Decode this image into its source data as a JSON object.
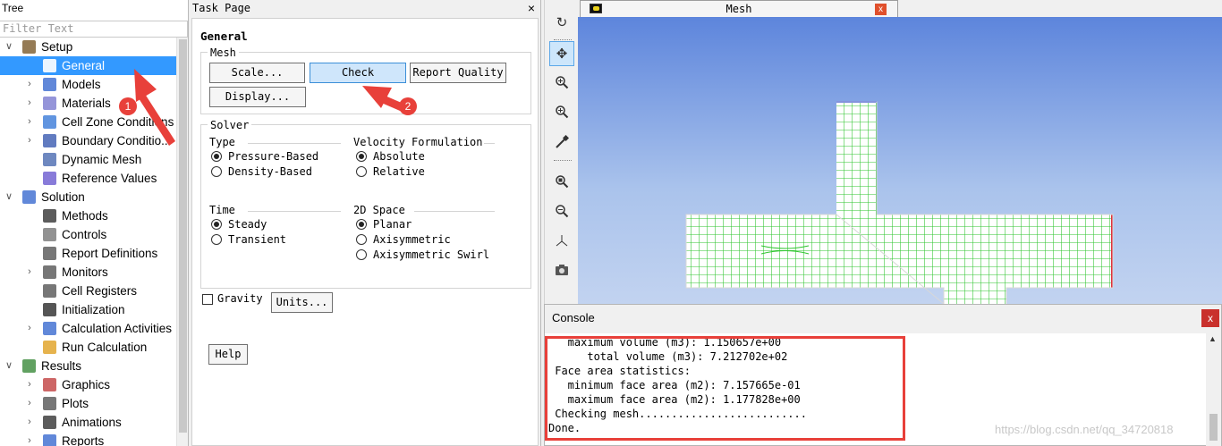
{
  "tree": {
    "title": "Tree",
    "filter_placeholder": "Filter Text",
    "items": [
      {
        "label": "Setup",
        "level": 0,
        "expander": "v",
        "icon": "setup-icon",
        "selected": false
      },
      {
        "label": "General",
        "level": 1,
        "expander": "",
        "icon": "general-icon",
        "selected": true
      },
      {
        "label": "Models",
        "level": 1,
        "expander": ">",
        "icon": "models-icon",
        "selected": false
      },
      {
        "label": "Materials",
        "level": 1,
        "expander": ">",
        "icon": "materials-icon",
        "selected": false
      },
      {
        "label": "Cell Zone Conditions",
        "level": 1,
        "expander": ">",
        "icon": "cell-zone-icon",
        "selected": false
      },
      {
        "label": "Boundary Conditio...",
        "level": 1,
        "expander": ">",
        "icon": "boundary-icon",
        "selected": false
      },
      {
        "label": "Dynamic Mesh",
        "level": 1,
        "expander": "",
        "icon": "dynamic-mesh-icon",
        "selected": false
      },
      {
        "label": "Reference Values",
        "level": 1,
        "expander": "",
        "icon": "reference-values-icon",
        "selected": false
      },
      {
        "label": "Solution",
        "level": 0,
        "expander": "v",
        "icon": "solution-icon",
        "selected": false
      },
      {
        "label": "Methods",
        "level": 1,
        "expander": "",
        "icon": "methods-icon",
        "selected": false
      },
      {
        "label": "Controls",
        "level": 1,
        "expander": "",
        "icon": "controls-icon",
        "selected": false
      },
      {
        "label": "Report Definitions",
        "level": 1,
        "expander": "",
        "icon": "report-definitions-icon",
        "selected": false
      },
      {
        "label": "Monitors",
        "level": 1,
        "expander": ">",
        "icon": "monitors-icon",
        "selected": false
      },
      {
        "label": "Cell Registers",
        "level": 1,
        "expander": "",
        "icon": "cell-registers-icon",
        "selected": false
      },
      {
        "label": "Initialization",
        "level": 1,
        "expander": "",
        "icon": "initialization-icon",
        "selected": false
      },
      {
        "label": "Calculation Activities",
        "level": 1,
        "expander": ">",
        "icon": "calculation-activities-icon",
        "selected": false
      },
      {
        "label": "Run Calculation",
        "level": 1,
        "expander": "",
        "icon": "run-calculation-icon",
        "selected": false
      },
      {
        "label": "Results",
        "level": 0,
        "expander": "v",
        "icon": "results-icon",
        "selected": false
      },
      {
        "label": "Graphics",
        "level": 1,
        "expander": ">",
        "icon": "graphics-icon",
        "selected": false
      },
      {
        "label": "Plots",
        "level": 1,
        "expander": ">",
        "icon": "plots-icon",
        "selected": false
      },
      {
        "label": "Animations",
        "level": 1,
        "expander": ">",
        "icon": "animations-icon",
        "selected": false
      },
      {
        "label": "Reports",
        "level": 1,
        "expander": ">",
        "icon": "reports-icon",
        "selected": false
      }
    ]
  },
  "task": {
    "title": "Task Page",
    "close": "×",
    "heading": "General",
    "mesh": {
      "label": "Mesh",
      "scale": "Scale...",
      "check": "Check",
      "report_quality": "Report Quality",
      "display": "Display..."
    },
    "solver": {
      "label": "Solver",
      "type_label": "Type",
      "type_options": [
        "Pressure-Based",
        "Density-Based"
      ],
      "type_selected": 0,
      "velocity_label": "Velocity Formulation",
      "velocity_options": [
        "Absolute",
        "Relative"
      ],
      "velocity_selected": 0,
      "time_label": "Time",
      "time_options": [
        "Steady",
        "Transient"
      ],
      "time_selected": 0,
      "space_label": "2D Space",
      "space_options": [
        "Planar",
        "Axisymmetric",
        "Axisymmetric Swirl"
      ],
      "space_selected": 0
    },
    "gravity": "Gravity",
    "gravity_checked": false,
    "units": "Units...",
    "help": "Help"
  },
  "toolbar": {
    "icons": [
      "rotate-icon",
      "pan-icon",
      "zoom-in-out-icon",
      "zoom-in-icon",
      "probe-icon",
      "fit-to-window-icon",
      "zoom-to-area-icon",
      "axes-icon",
      "snapshot-icon"
    ]
  },
  "mesh_window": {
    "title": "Mesh",
    "close": "x"
  },
  "console": {
    "title": "Console",
    "close": "x",
    "lines": [
      "   maximum volume (m3): 1.150657e+00",
      "      total volume (m3): 7.212702e+02",
      " Face area statistics:",
      "   minimum face area (m2): 7.157665e-01",
      "   maximum face area (m2): 1.177828e+00",
      " Checking mesh..........................",
      "Done."
    ]
  },
  "annotations": {
    "badge1": "1",
    "badge2": "2",
    "highlight_color": "#e8403a"
  },
  "watermark": "https://blog.csdn.net/qq_34720818"
}
